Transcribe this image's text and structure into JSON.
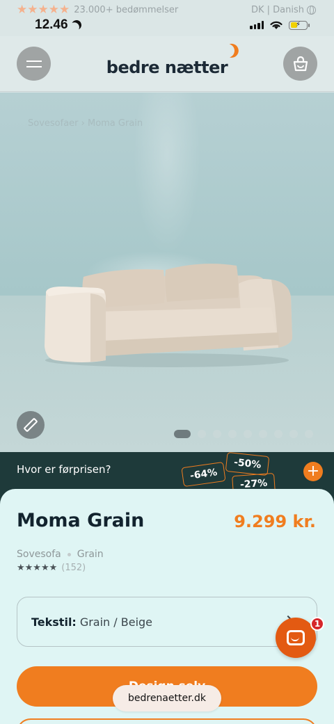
{
  "top_bar": {
    "stars": "★★★★★",
    "rating_text": "23.000+ bedømmelser",
    "locale": "DK | Danish"
  },
  "status_bar": {
    "time": "12.46",
    "battery_level": 0.45
  },
  "header": {
    "logo": "bedre nætter"
  },
  "hero": {
    "breadcrumb": "Sovesofaer  ›  Moma Grain",
    "carousel": {
      "total": 9,
      "active_index": 0
    }
  },
  "promo": {
    "question": "Hvor er førprisen?",
    "tags": [
      "-64%",
      "-50%",
      "-27%"
    ],
    "plus": "+"
  },
  "product": {
    "name": "Moma Grain",
    "price": "9.299 kr.",
    "category": "Sovesofa",
    "variant": "Grain",
    "stars": "★★★★★",
    "review_count": "(152)",
    "textile_label": "Tekstil:",
    "textile_value": "Grain / Beige",
    "chat_badge": "1",
    "primary_button": "Design selv"
  },
  "browser": {
    "url": "bedrenaetter.dk"
  },
  "colors": {
    "accent": "#f07d1f",
    "promo_bg": "#1e3a3a",
    "card_bg": "#dff5f4"
  }
}
